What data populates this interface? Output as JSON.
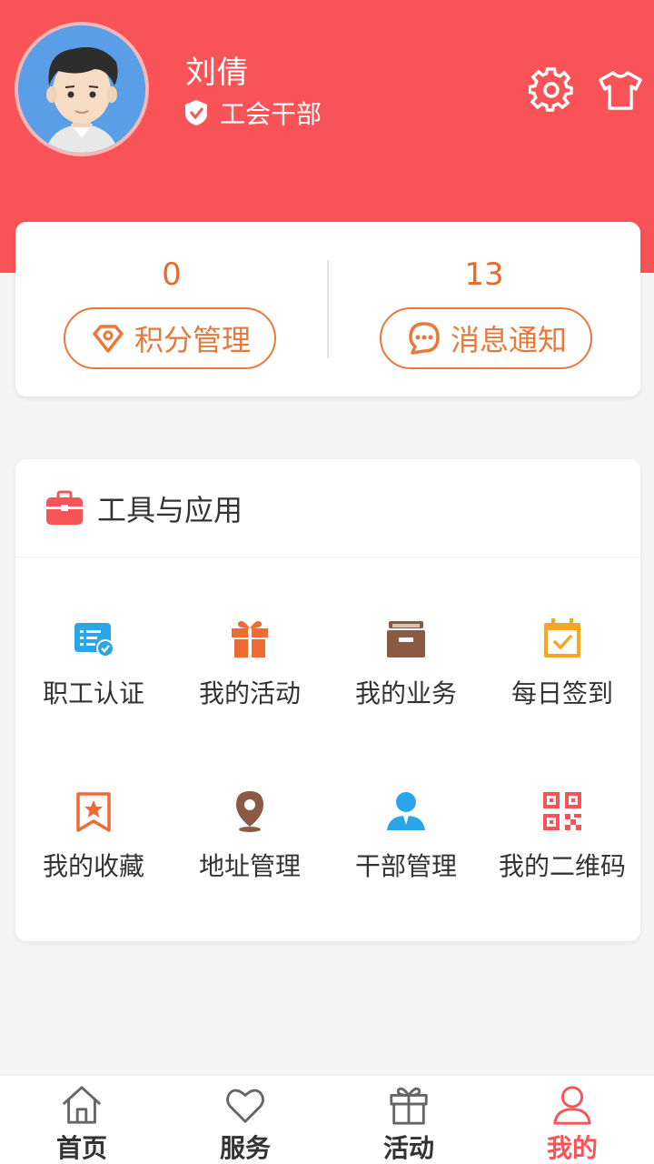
{
  "profile": {
    "name": "刘倩",
    "role": "工会干部"
  },
  "header_icons": [
    "gear-icon",
    "tshirt-icon"
  ],
  "stats": [
    {
      "value": "0",
      "label": "积分管理",
      "icon": "diamond-icon"
    },
    {
      "value": "13",
      "label": "消息通知",
      "icon": "chat-icon"
    }
  ],
  "tools": {
    "title": "工具与应用",
    "items": [
      {
        "label": "职工认证",
        "icon": "id-card-icon",
        "color": "#2aa6e8"
      },
      {
        "label": "我的活动",
        "icon": "gift-icon",
        "color": "#f06a35"
      },
      {
        "label": "我的业务",
        "icon": "archive-box-icon",
        "color": "#8a5a44"
      },
      {
        "label": "每日签到",
        "icon": "calendar-check-icon",
        "color": "#f5a623"
      },
      {
        "label": "我的收藏",
        "icon": "bookmark-star-icon",
        "color": "#f06a35"
      },
      {
        "label": "地址管理",
        "icon": "location-pin-icon",
        "color": "#8a5a44"
      },
      {
        "label": "干部管理",
        "icon": "person-icon",
        "color": "#2aa6e8"
      },
      {
        "label": "我的二维码",
        "icon": "qr-code-icon",
        "color": "#f85458"
      }
    ]
  },
  "tabbar": {
    "items": [
      {
        "label": "首页",
        "icon": "home-icon"
      },
      {
        "label": "服务",
        "icon": "heart-icon"
      },
      {
        "label": "活动",
        "icon": "gift-icon"
      },
      {
        "label": "我的",
        "icon": "user-icon"
      }
    ],
    "active": "我的"
  },
  "colors": {
    "header": "#f85458",
    "accent": "#e8793a",
    "active_tab": "#f85458"
  }
}
